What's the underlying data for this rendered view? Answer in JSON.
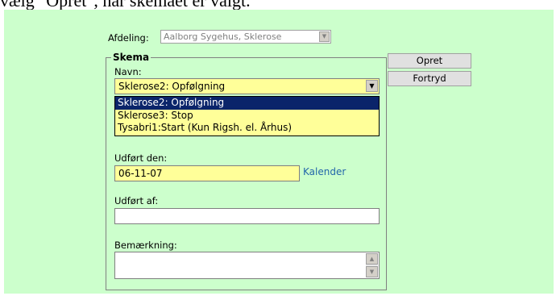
{
  "caption": "vælg \"Opret\", når skemaet er valgt.",
  "department": {
    "label": "Afdeling:",
    "value": "Aalborg Sygehus, Sklerose"
  },
  "schema": {
    "legend": "Skema",
    "name_label": "Navn:",
    "selected": "Sklerose2: Opfølgning",
    "options": [
      "Sklerose2: Opfølgning",
      "Sklerose3: Stop",
      "Tysabri1:Start (Kun Rigsh. el. Århus)"
    ],
    "done_date_label": "Udført den:",
    "done_date_value": "06-11-07",
    "calendar_link": "Kalender",
    "done_by_label": "Udført af:",
    "done_by_value": "",
    "remark_label": "Bemærkning:"
  },
  "buttons": {
    "create": "Opret",
    "cancel": "Fortryd"
  },
  "colors": {
    "panel_bg": "#ccffcc",
    "field_bg": "#ffff99",
    "selection_bg": "#0a246a",
    "link": "#2266aa"
  }
}
